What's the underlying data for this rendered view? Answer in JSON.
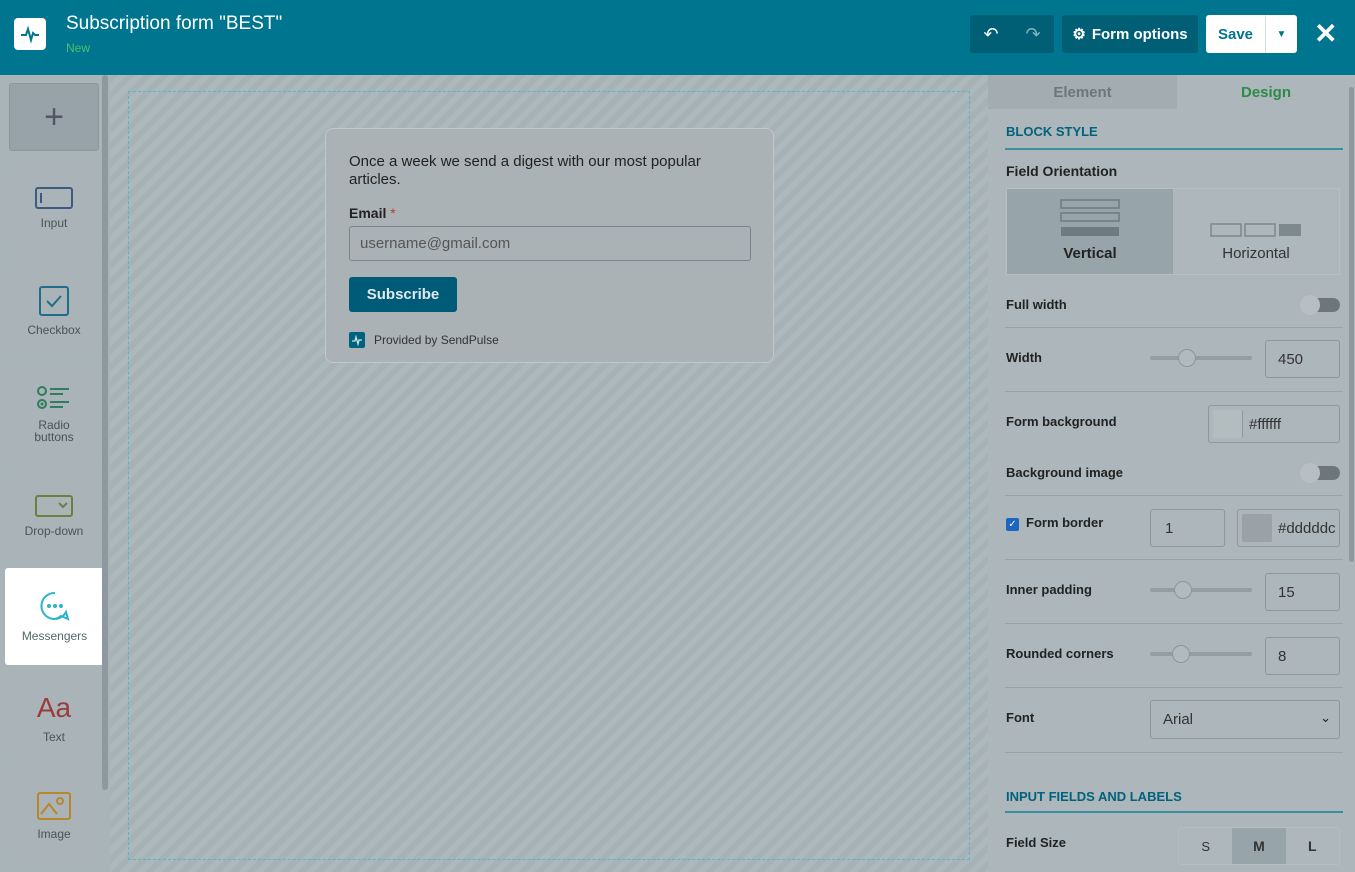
{
  "header": {
    "title": "Subscription form \"BEST\"",
    "status": "New",
    "undo_icon": "↶",
    "redo_icon": "↷",
    "form_options_label": "Form options",
    "save_label": "Save",
    "close_icon": "✕"
  },
  "sidebar": {
    "add_icon": "+",
    "tools": [
      {
        "label": "Input",
        "icon": "input-icon"
      },
      {
        "label": "Checkbox",
        "icon": "checkbox-icon"
      },
      {
        "label": "Radio buttons",
        "icon": "radio-buttons-icon"
      },
      {
        "label": "Drop-down",
        "icon": "dropdown-icon"
      },
      {
        "label": "Messengers",
        "icon": "chat-bubble-icon"
      },
      {
        "label": "Text",
        "icon": "text-icon",
        "glyph": "Aa"
      },
      {
        "label": "Image",
        "icon": "image-icon"
      }
    ]
  },
  "form": {
    "description": "Once a week we send a digest with our most popular articles.",
    "email_label": "Email",
    "required_mark": "*",
    "email_placeholder": "username@gmail.com",
    "subscribe_label": "Subscribe",
    "provided_by": "Provided by SendPulse"
  },
  "panel": {
    "tabs": [
      "Element",
      "Design"
    ],
    "block_style_title": "BLOCK STYLE",
    "field_orientation_label": "Field Orientation",
    "orientation_options": [
      "Vertical",
      "Horizontal"
    ],
    "full_width_label": "Full width",
    "width_label": "Width",
    "width_value": "450",
    "form_background_label": "Form background",
    "form_background_value": "#ffffff",
    "background_image_label": "Background image",
    "form_border_label": "Form border",
    "form_border_width": "1",
    "form_border_color": "#dddddc",
    "inner_padding_label": "Inner padding",
    "inner_padding_value": "15",
    "rounded_corners_label": "Rounded corners",
    "rounded_corners_value": "8",
    "font_label": "Font",
    "font_value": "Arial",
    "input_fields_title": "INPUT FIELDS AND LABELS",
    "field_size_label": "Field Size",
    "field_sizes": [
      "S",
      "M",
      "L"
    ],
    "field_size_selected": "M"
  },
  "colors": {
    "header": "#00758f",
    "accent_green": "#2c8a4a",
    "subscribe_button": "#005b79"
  }
}
